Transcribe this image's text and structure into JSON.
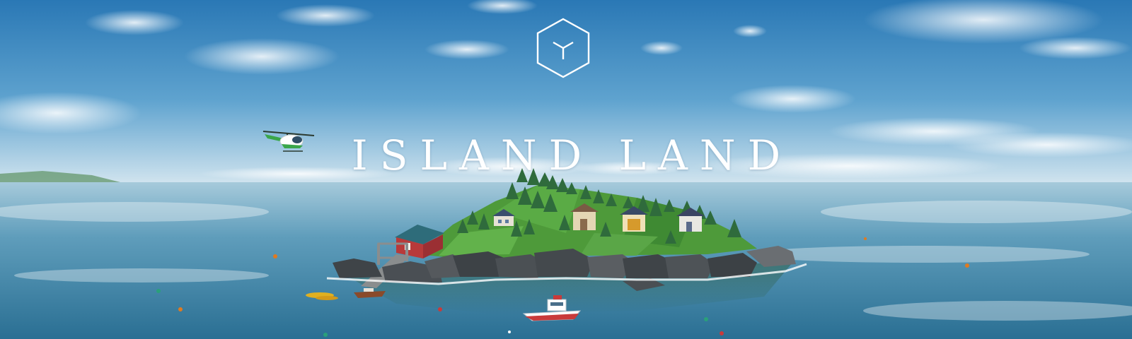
{
  "title_screen": {
    "game_title": "ISLAND LAND",
    "logo_icon": "isometric-cube-icon"
  },
  "scene": {
    "description_icons": [
      "helicopter-icon",
      "boat-icon",
      "kayak-icon",
      "buoy-icon",
      "house-icon",
      "tree-icon",
      "rock-icon"
    ]
  },
  "colors": {
    "sky_top": "#2b79b6",
    "sky_horizon": "#cfe3ee",
    "sea_horizon": "#9cc5d8",
    "sea_bottom": "#2a6f93",
    "grass": "#4e9a3a",
    "tree": "#2f6b3c",
    "rock": "#454a4f",
    "barn_red": "#b83a3a",
    "helicopter_green": "#3aa64a",
    "title_text": "#ffffff"
  }
}
